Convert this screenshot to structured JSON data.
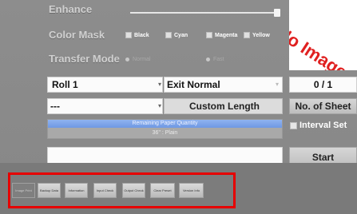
{
  "enhance": {
    "label": "Enhance"
  },
  "color_mask": {
    "label": "Color Mask",
    "options": [
      "Black",
      "Cyan",
      "Magenta",
      "Yellow"
    ]
  },
  "transfer_mode": {
    "label": "Transfer Mode",
    "options": [
      "Normal",
      "Fast"
    ]
  },
  "preview": {
    "text": "No Image"
  },
  "roll": {
    "value": "Roll 1"
  },
  "exit": {
    "value": "Exit Normal"
  },
  "counter": {
    "value": "0 / 1"
  },
  "size_select": {
    "value": "---"
  },
  "custom_length": {
    "label": "Custom Length"
  },
  "no_of_sheet": {
    "label": "No. of Sheet"
  },
  "remaining": {
    "label": "Remaining Paper Quantity",
    "detail": "36\" : Plain",
    "level_percent": 100
  },
  "interval_set": {
    "label": "Interval Set"
  },
  "start": {
    "label": "Start"
  },
  "toolbar": {
    "buttons": [
      "Image Print",
      "Backup Data",
      "Information",
      "Input Check",
      "Output Check",
      "Clear Preset",
      "Version Info"
    ]
  },
  "colors": {
    "highlight_border": "#e60000",
    "progress_fill": "#7aa1e8",
    "preview_text": "#e02020"
  }
}
